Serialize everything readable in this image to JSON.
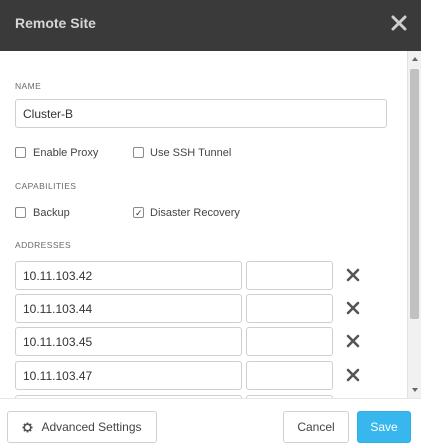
{
  "dialog": {
    "title": "Remote Site",
    "close_icon": "close-icon"
  },
  "name_section": {
    "label": "NAME",
    "value": "Cluster-B"
  },
  "options": {
    "enable_proxy": {
      "label": "Enable Proxy",
      "checked": false
    },
    "use_ssh_tunnel": {
      "label": "Use SSH Tunnel",
      "checked": false
    }
  },
  "capabilities": {
    "label": "CAPABILITIES",
    "backup": {
      "label": "Backup",
      "checked": false
    },
    "disaster_recovery": {
      "label": "Disaster Recovery",
      "checked": true,
      "mark": "✓"
    }
  },
  "addresses": {
    "label": "ADDRESSES",
    "rows": [
      {
        "ip": "10.11.103.42",
        "port": ""
      },
      {
        "ip": "10.11.103.44",
        "port": ""
      },
      {
        "ip": "10.11.103.45",
        "port": ""
      },
      {
        "ip": "10.11.103.47",
        "port": ""
      }
    ]
  },
  "footer": {
    "advanced_label": "Advanced Settings",
    "cancel_label": "Cancel",
    "save_label": "Save"
  },
  "colors": {
    "titlebar": "#3a3a3a",
    "accent": "#37b7ee"
  }
}
